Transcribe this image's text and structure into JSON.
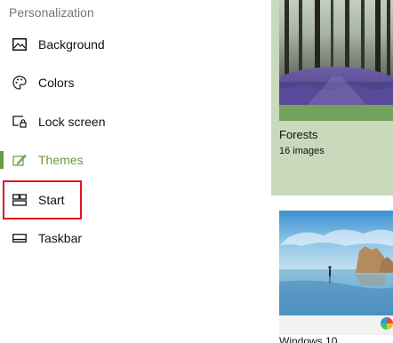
{
  "sidebar": {
    "section_title": "Personalization",
    "items": [
      {
        "label": "Background",
        "icon": "image-icon"
      },
      {
        "label": "Colors",
        "icon": "palette-icon"
      },
      {
        "label": "Lock screen",
        "icon": "lock-screen-icon"
      },
      {
        "label": "Themes",
        "icon": "themes-icon",
        "active": true
      },
      {
        "label": "Start",
        "icon": "start-icon",
        "highlighted": true
      },
      {
        "label": "Taskbar",
        "icon": "taskbar-icon"
      }
    ]
  },
  "themes": [
    {
      "name": "Forests",
      "count": "16 images"
    },
    {
      "name": "Windows 10"
    }
  ],
  "colors": {
    "accent": "#6a9a3c",
    "highlight": "#e0161d",
    "card_background": "#c9d9bb",
    "card_accent": "#74a15b"
  }
}
